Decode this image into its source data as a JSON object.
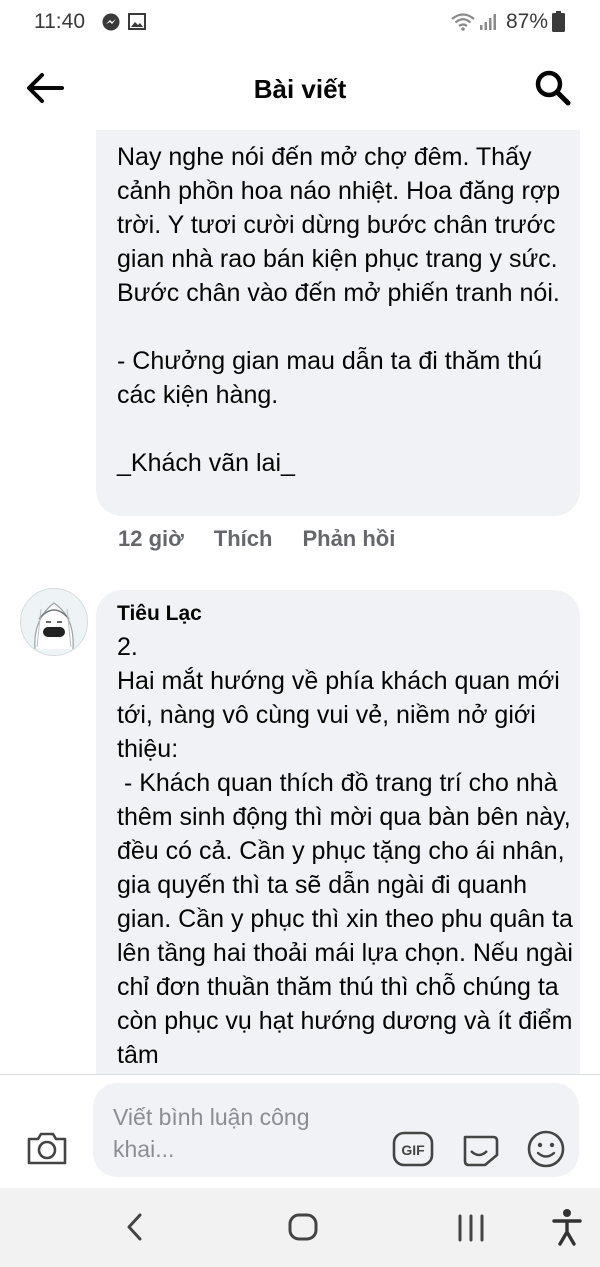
{
  "status_bar": {
    "time": "11:40",
    "battery": "87%",
    "icons": [
      "messenger-icon",
      "image-icon",
      "wifi-icon",
      "signal-icon",
      "battery-icon"
    ]
  },
  "header": {
    "title": "Bài viết",
    "back_icon": "arrow-left-icon",
    "search_icon": "search-icon"
  },
  "comments": [
    {
      "text": "Nay nghe nói đến mở chợ đêm. Thấy cảnh phồn hoa náo nhiệt. Hoa đăng rợp trời. Y tươi cười dừng bước chân trước gian nhà rao bán kiện phục trang y sức. Bước chân vào đến mở phiến tranh nói.\n\n- Chưởng gian mau dẫn ta đi thăm thú các kiện hàng.\n\n_Khách vãn lai_",
      "time": "12 giờ",
      "like_label": "Thích",
      "reply_label": "Phản hồi"
    },
    {
      "author": "Tiêu Lạc",
      "text": "2.\nHai mắt hướng về phía khách quan mới tới, nàng vô cùng vui vẻ, niềm nở giới thiệu:\n - Khách quan thích đồ trang trí cho nhà thêm sinh động thì mời qua bàn bên này, đều có cả. Cần y phục tặng cho ái nhân, gia quyến thì ta sẽ dẫn ngài đi quanh gian. Cần y phục thì xin theo phu quân ta lên tầng hai thoải mái lựa chọn. Nếu ngài chỉ đơn thuần thăm thú thì chỗ chúng ta còn phục vụ hạt hướng dương và ít điểm tâm"
    }
  ],
  "composer": {
    "placeholder": "Viết bình luận công khai...",
    "gif_label": "GIF",
    "icons": [
      "camera-icon",
      "gif-icon",
      "sticker-icon",
      "emoji-icon"
    ]
  },
  "nav_bar": {
    "icons": [
      "nav-back-icon",
      "nav-home-icon",
      "nav-recent-apps-icon",
      "accessibility-icon"
    ]
  },
  "colors": {
    "bubble_bg": "#f0f2f5",
    "meta_text": "#65676b",
    "placeholder": "#8a8d91",
    "nav_bar_bg": "#f2f2f2"
  }
}
